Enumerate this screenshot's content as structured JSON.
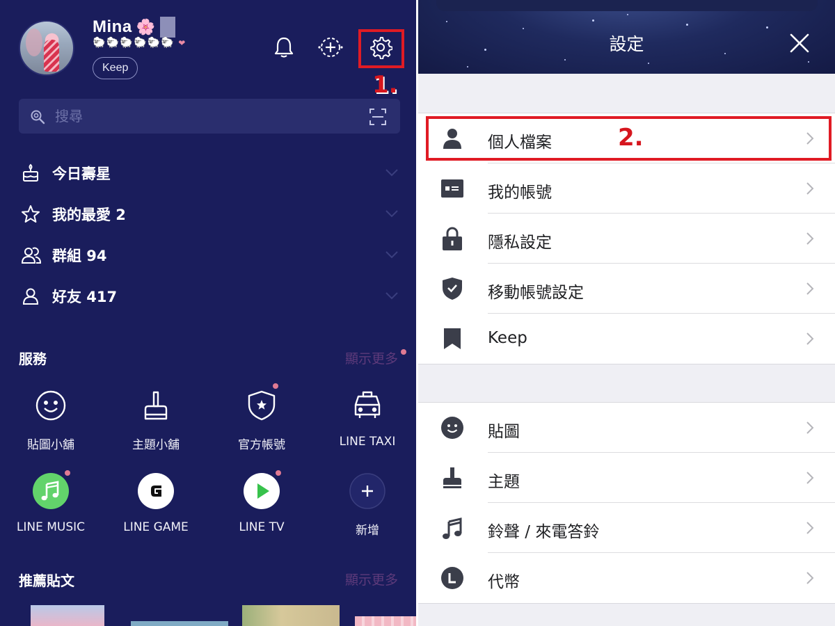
{
  "left": {
    "profile": {
      "name": "Mina",
      "name_emoji": "🌸",
      "status": "🐑🐑🐑🐑🐑🐑",
      "status_heart": "❤",
      "keep_label": "Keep"
    },
    "step1_label": "1.",
    "search": {
      "placeholder": "搜尋"
    },
    "list": [
      {
        "label": "今日壽星",
        "icon": "birthday-cake-icon"
      },
      {
        "label": "我的最愛 2",
        "icon": "star-icon"
      },
      {
        "label": "群組 94",
        "icon": "group-icon"
      },
      {
        "label": "好友 417",
        "icon": "person-icon"
      }
    ],
    "services": {
      "title": "服務",
      "show_more": "顯示更多",
      "items": [
        {
          "label": "貼圖小舖",
          "icon": "smiley-icon"
        },
        {
          "label": "主題小舖",
          "icon": "brush-icon"
        },
        {
          "label": "官方帳號",
          "icon": "shield-star-icon"
        },
        {
          "label": "LINE TAXI",
          "icon": "taxi-icon"
        },
        {
          "label": "LINE MUSIC",
          "icon": "music-note-icon"
        },
        {
          "label": "LINE GAME",
          "icon": "game-g-icon"
        },
        {
          "label": "LINE TV",
          "icon": "play-icon"
        },
        {
          "label": "新增",
          "icon": "plus-icon"
        }
      ]
    },
    "recommended": {
      "title": "推薦貼文",
      "show_more": "顯示更多"
    },
    "colors": {
      "background": "#1a1d5c",
      "highlight": "#e01b24",
      "music_green": "#62d36b"
    }
  },
  "right": {
    "title": "設定",
    "step2_label": "2.",
    "group1": [
      {
        "label": "個人檔案",
        "icon": "person-icon"
      },
      {
        "label": "我的帳號",
        "icon": "id-card-icon"
      },
      {
        "label": "隱私設定",
        "icon": "lock-icon"
      },
      {
        "label": "移動帳號設定",
        "icon": "shield-check-icon"
      },
      {
        "label": "Keep",
        "icon": "bookmark-icon"
      }
    ],
    "group2": [
      {
        "label": "貼圖",
        "icon": "smiley-icon"
      },
      {
        "label": "主題",
        "icon": "brush-icon"
      },
      {
        "label": "鈴聲 / 來電答鈴",
        "icon": "music-note-icon"
      },
      {
        "label": "代幣",
        "icon": "coin-icon"
      }
    ]
  }
}
